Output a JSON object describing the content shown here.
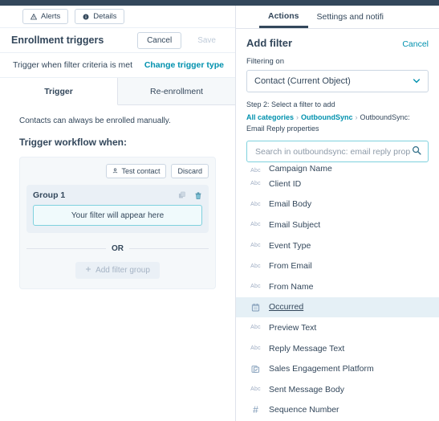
{
  "topbar": {
    "color": "#33475b"
  },
  "left": {
    "actionbar": [
      {
        "label": "Alerts",
        "icon": "warning-icon"
      },
      {
        "label": "Details",
        "icon": "info-icon"
      }
    ],
    "enrollment": {
      "title": "Enrollment triggers",
      "cancel_label": "Cancel",
      "save_label": "Save"
    },
    "trigger_row": {
      "text": "Trigger when filter criteria is met",
      "link": "Change trigger type"
    },
    "tabs": [
      {
        "label": "Trigger",
        "active": true
      },
      {
        "label": "Re-enrollment",
        "active": false
      }
    ],
    "note": "Contacts can always be enrolled manually.",
    "section_title": "Trigger workflow when:",
    "card": {
      "test_contact_label": "Test contact",
      "discard_label": "Discard",
      "group_name": "Group 1",
      "filter_placeholder": "Your filter will appear here",
      "or_label": "OR",
      "add_group_label": "Add filter group"
    }
  },
  "right": {
    "nav": [
      {
        "label": "Actions",
        "active": true
      },
      {
        "label": "Settings and notifi",
        "active": false
      }
    ],
    "panel": {
      "title": "Add filter",
      "cancel_label": "Cancel",
      "filtering_on_label": "Filtering on",
      "object_value": "Contact (Current Object)",
      "step_label": "Step 2: Select a filter to add",
      "breadcrumb": [
        "All categories",
        "OutboundSync",
        "OutboundSync: Email Reply properties"
      ],
      "search_placeholder": "Search in outboundsync: email reply prop"
    },
    "properties": [
      {
        "label": "Campaign Name",
        "icon": "abc-icon",
        "clipped": true,
        "selected": false
      },
      {
        "label": "Client ID",
        "icon": "abc-icon",
        "clipped": false,
        "selected": false
      },
      {
        "label": "Email Body",
        "icon": "abc-icon",
        "clipped": false,
        "selected": false
      },
      {
        "label": "Email Subject",
        "icon": "abc-icon",
        "clipped": false,
        "selected": false
      },
      {
        "label": "Event Type",
        "icon": "abc-icon",
        "clipped": false,
        "selected": false
      },
      {
        "label": "From Email",
        "icon": "abc-icon",
        "clipped": false,
        "selected": false
      },
      {
        "label": "From Name",
        "icon": "abc-icon",
        "clipped": false,
        "selected": false
      },
      {
        "label": "Occurred",
        "icon": "calendar-icon",
        "clipped": false,
        "selected": true
      },
      {
        "label": "Preview Text",
        "icon": "abc-icon",
        "clipped": false,
        "selected": false
      },
      {
        "label": "Reply Message Text",
        "icon": "abc-icon",
        "clipped": false,
        "selected": false
      },
      {
        "label": "Sales Engagement Platform",
        "icon": "enumeration-icon",
        "clipped": false,
        "selected": false
      },
      {
        "label": "Sent Message Body",
        "icon": "abc-icon",
        "clipped": false,
        "selected": false
      },
      {
        "label": "Sequence Number",
        "icon": "number-icon",
        "clipped": false,
        "selected": false
      }
    ]
  },
  "colors": {
    "brand_teal": "#0091ae",
    "navy": "#33475b",
    "selected_row": "#e5f0f6"
  }
}
